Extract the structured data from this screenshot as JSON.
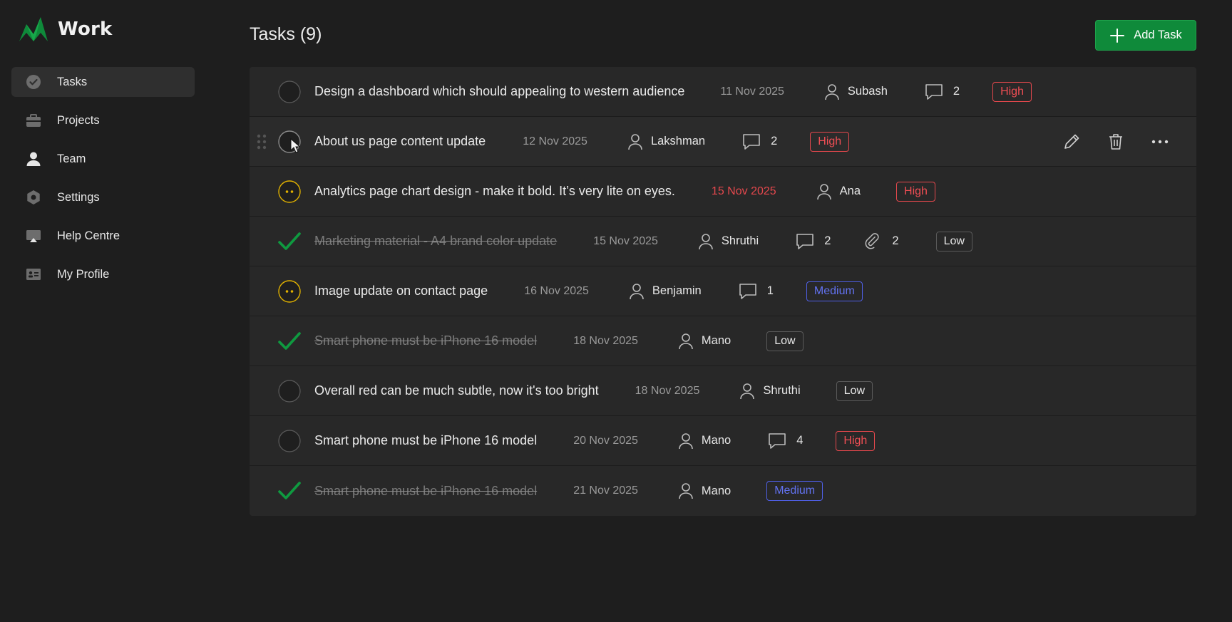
{
  "app": {
    "name": "Work",
    "accent": "#0f8a3a"
  },
  "sidebar": {
    "items": [
      {
        "label": "Tasks",
        "icon": "check-circle-icon",
        "active": true
      },
      {
        "label": "Projects",
        "icon": "briefcase-icon"
      },
      {
        "label": "Team",
        "icon": "person-icon"
      },
      {
        "label": "Settings",
        "icon": "gear-icon"
      },
      {
        "label": "Help Centre",
        "icon": "monitor-icon"
      },
      {
        "label": "My Profile",
        "icon": "id-card-icon"
      }
    ]
  },
  "header": {
    "title": "Tasks (9)",
    "add_label": "Add Task"
  },
  "tasks": [
    {
      "title": "Design a dashboard which should appealing to western audience",
      "date": "11 Nov 2025",
      "assignee": "Subash",
      "comments": "2",
      "priority": "High",
      "status": "open"
    },
    {
      "title": "About us page content update",
      "date": "12 Nov 2025",
      "assignee": "Lakshman",
      "comments": "2",
      "priority": "High",
      "status": "open",
      "hovered": true
    },
    {
      "title": "Analytics page chart design - make it bold. It’s very lite on eyes.",
      "date": "15 Nov 2025",
      "assignee": "Ana",
      "priority": "High",
      "status": "in-progress",
      "overdue": true
    },
    {
      "title": "Marketing material - A4 brand color update",
      "date": "15 Nov 2025",
      "assignee": "Shruthi",
      "comments": "2",
      "attachments": "2",
      "priority": "Low",
      "status": "done"
    },
    {
      "title": "Image update on contact page",
      "date": "16 Nov 2025",
      "assignee": "Benjamin",
      "comments": "1",
      "priority": "Medium",
      "status": "in-progress"
    },
    {
      "title": "Smart phone must be iPhone 16 model",
      "date": "18 Nov 2025",
      "assignee": "Mano",
      "priority": "Low",
      "status": "done"
    },
    {
      "title": "Overall red can be much subtle, now it's too bright",
      "date": "18 Nov 2025",
      "assignee": "Shruthi",
      "priority": "Low",
      "status": "open"
    },
    {
      "title": "Smart phone must be iPhone 16 model",
      "date": "20 Nov 2025",
      "assignee": "Mano",
      "comments": "4",
      "priority": "High",
      "status": "open"
    },
    {
      "title": "Smart phone must be iPhone 16 model",
      "date": "21 Nov 2025",
      "assignee": "Mano",
      "priority": "Medium",
      "status": "done"
    }
  ],
  "colors": {
    "high": "#e5484d",
    "medium": "#4f5fe6",
    "done": "#0f8a3a",
    "in_progress": "#e0b100"
  }
}
